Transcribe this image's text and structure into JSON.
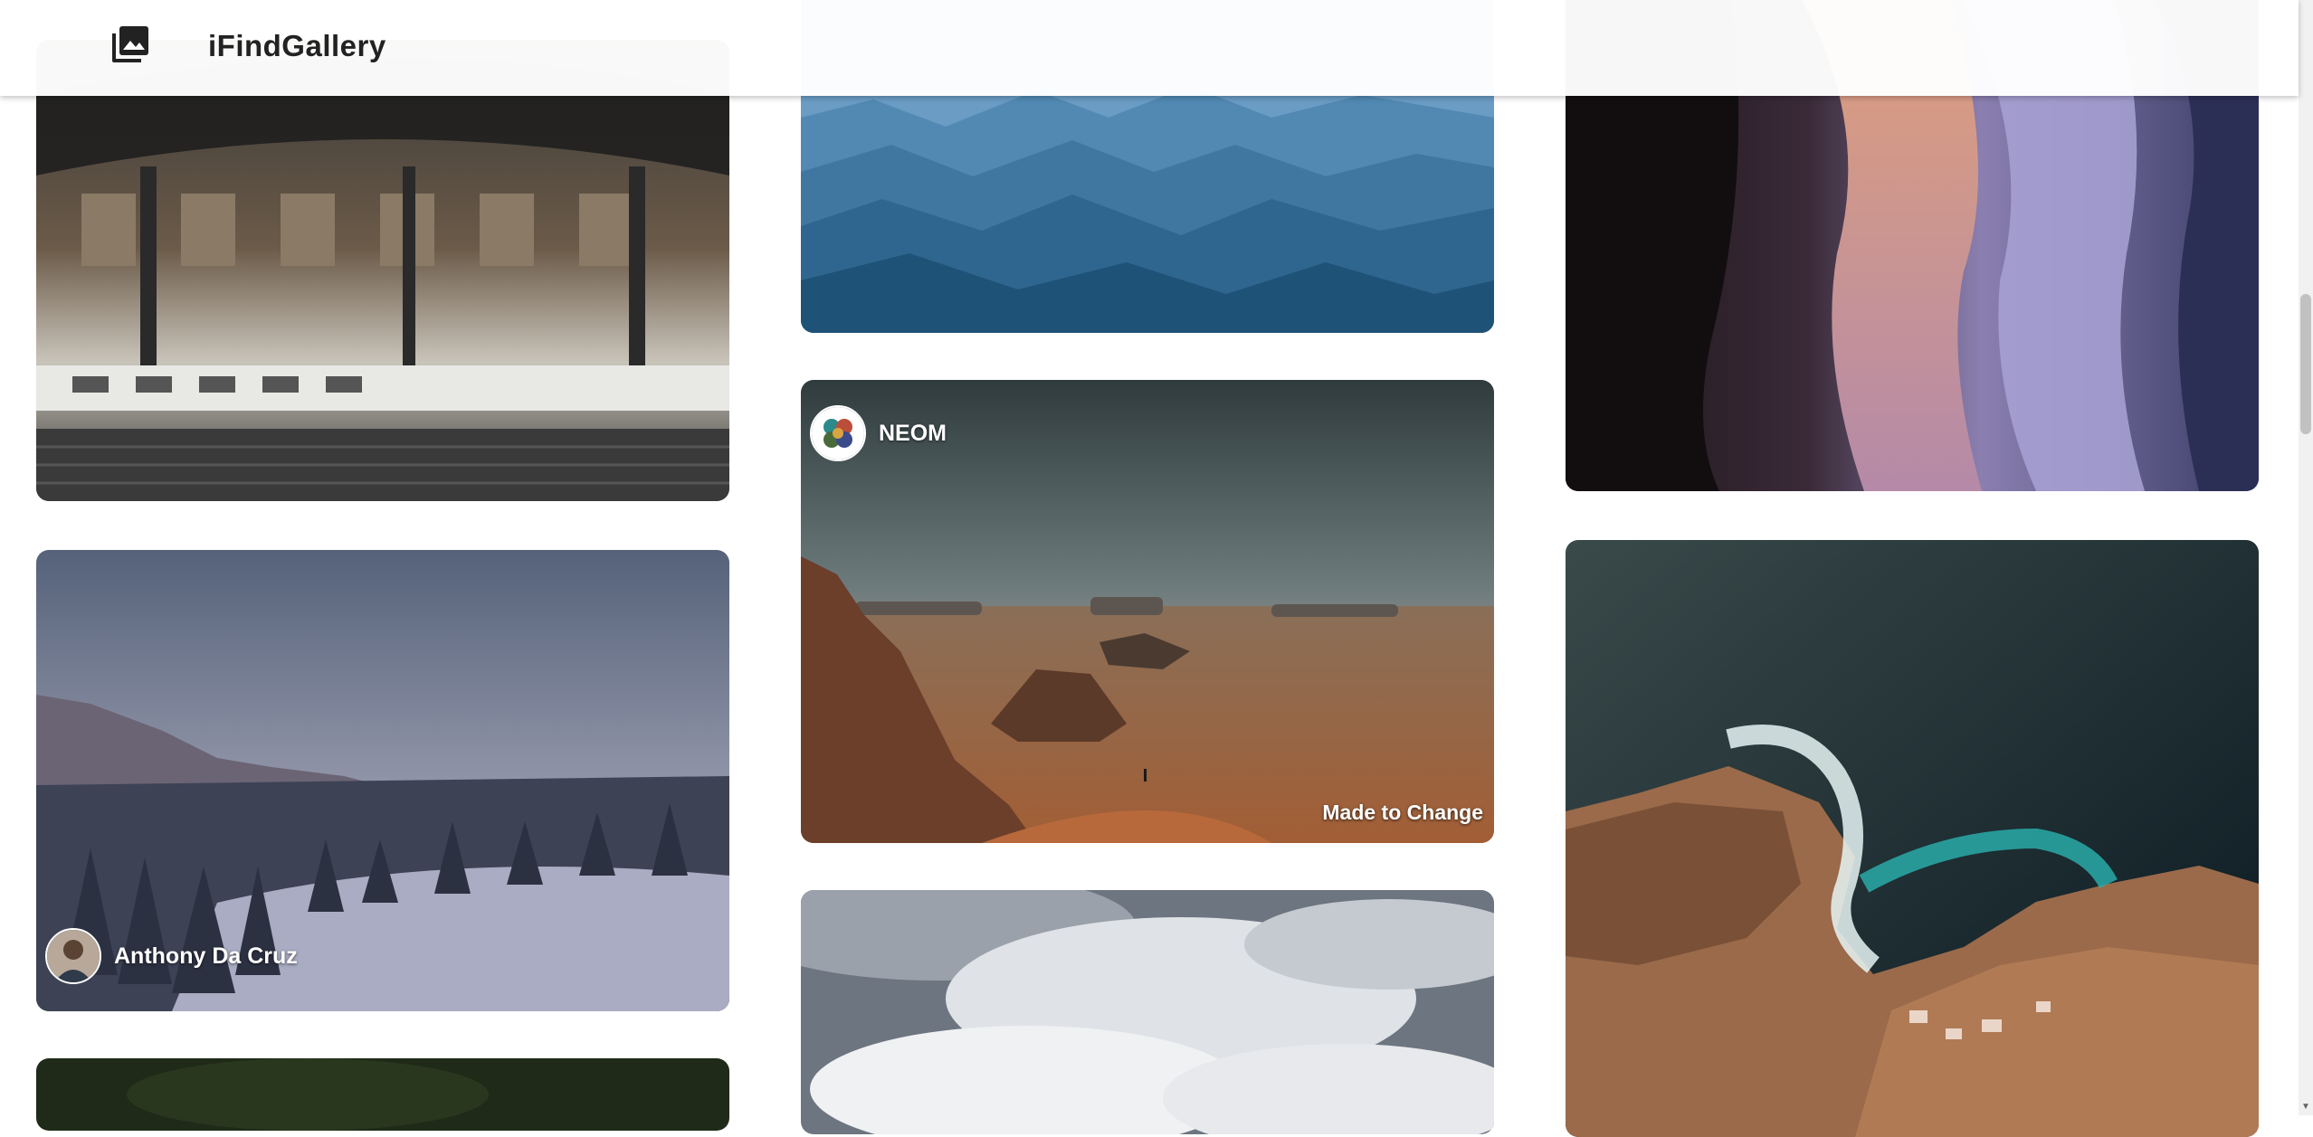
{
  "app": {
    "title": "iFindGallery",
    "logo_icon": "photo-library-icon"
  },
  "cards": [
    {
      "id": "train-station",
      "author": ""
    },
    {
      "id": "snowy-forest",
      "author": "Anthony Da Cruz"
    },
    {
      "id": "blue-mountains",
      "author": ""
    },
    {
      "id": "desert-canyon",
      "author": "NEOM",
      "caption": "Made to Change"
    },
    {
      "id": "cloudy-sky",
      "author": ""
    },
    {
      "id": "slot-canyon",
      "author": ""
    },
    {
      "id": "coastal-rocks",
      "author": ""
    },
    {
      "id": "green-forest",
      "author": ""
    }
  ],
  "colors": {
    "header_bg": "#ffffff",
    "text": "#222222",
    "scrollbar_thumb": "#c1c1c1"
  }
}
